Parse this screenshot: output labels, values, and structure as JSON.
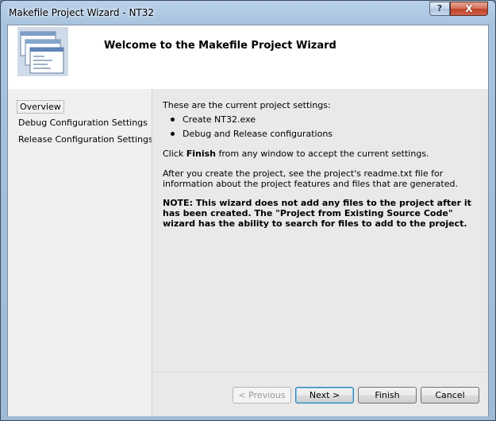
{
  "window": {
    "title": "Makefile Project Wizard - NT32",
    "help_glyph": "?",
    "close_glyph": "X"
  },
  "header": {
    "title": "Welcome to the Makefile Project Wizard",
    "icon": "wizard-windows-icon"
  },
  "nav": {
    "items": [
      {
        "label": "Overview",
        "selected": true
      },
      {
        "label": "Debug Configuration Settings",
        "selected": false
      },
      {
        "label": "Release Configuration Settings",
        "selected": false
      }
    ]
  },
  "content": {
    "intro": "These are the current project settings:",
    "bullets": [
      "Create NT32.exe",
      "Debug and Release configurations"
    ],
    "click_prefix": "Click ",
    "click_bold": "Finish",
    "click_suffix": " from any window to accept the current settings.",
    "after_create": "After you create the project, see the project's readme.txt file for information about the project features and files that are generated.",
    "note": "NOTE: This wizard does not add any files to the project after it has been created. The \"Project from Existing Source Code\" wizard has the ability to search for files to add to the project."
  },
  "buttons": {
    "previous": "< Previous",
    "next": "Next >",
    "finish": "Finish",
    "cancel": "Cancel"
  }
}
